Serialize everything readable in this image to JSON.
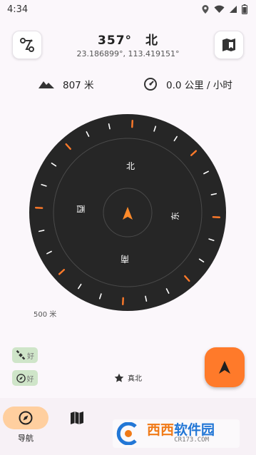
{
  "status": {
    "time": "4:34",
    "icons": [
      "location-icon",
      "wifi-icon",
      "signal-icon",
      "battery-icon"
    ]
  },
  "header": {
    "heading_degrees": "357°",
    "heading_direction": "北",
    "coordinates": "23.186899°, 113.419151°",
    "left_button_icon": "route-icon",
    "right_button_icon": "map-bookmark-icon"
  },
  "info": {
    "altitude": "807 米",
    "speed": "0.0 公里 / 小时"
  },
  "compass": {
    "heading_value": 357,
    "labels": {
      "north": "北",
      "east": "东",
      "south": "南",
      "west": "西"
    }
  },
  "scale": {
    "label": "500 米"
  },
  "status_chips": [
    {
      "icon": "satellite-icon",
      "label": "好"
    },
    {
      "icon": "compass-icon",
      "label": "好"
    }
  ],
  "true_north": {
    "icon": "star-icon",
    "label": "真北"
  },
  "fab": {
    "icon": "navigation-arrow-icon"
  },
  "bottom_nav": [
    {
      "icon": "compass-icon",
      "label": "导航",
      "selected": true
    },
    {
      "icon": "map-icon",
      "label": "",
      "selected": false
    }
  ],
  "watermark": {
    "main_a": "西西",
    "main_b": "软件园",
    "sub": "CR173.COM"
  },
  "colors": {
    "accent": "#ff7a2a",
    "dial": "#262626",
    "nav_pill": "#ffcf9f",
    "chip": "#cfe5c9"
  }
}
